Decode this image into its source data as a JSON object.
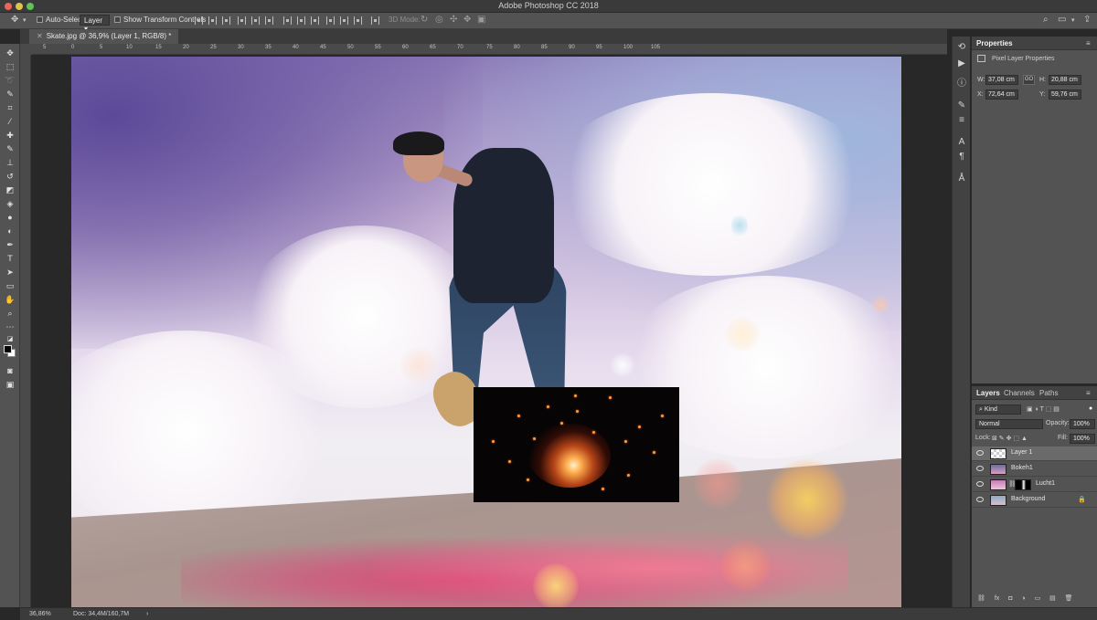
{
  "app": {
    "title": "Adobe Photoshop CC 2018"
  },
  "options_bar": {
    "auto_select_label": "Auto-Select:",
    "auto_select_target": "Layer",
    "show_transform_label": "Show Transform Controls",
    "mode_3d_label": "3D Mode:"
  },
  "document": {
    "tab_title": "Skate.jpg @ 36,9% (Layer 1, RGB/8) *",
    "zoom": "36,86%",
    "doc_size": "Doc: 34,4M/160,7M"
  },
  "ruler": {
    "horizontal": [
      "5",
      "0",
      "5",
      "10",
      "15",
      "20",
      "25",
      "30",
      "35",
      "40",
      "45",
      "50",
      "55",
      "60",
      "65",
      "70",
      "75",
      "80",
      "85",
      "90",
      "95",
      "100",
      "105"
    ]
  },
  "properties": {
    "tab": "Properties",
    "section": "Pixel Layer Properties",
    "w_label": "W:",
    "w_value": "37,08 cm",
    "link_label": "GO",
    "h_label": "H:",
    "h_value": "20,88 cm",
    "x_label": "X:",
    "x_value": "72,64 cm",
    "y_label": "Y:",
    "y_value": "59,76 cm"
  },
  "layers_panel": {
    "tabs": [
      "Layers",
      "Channels",
      "Paths"
    ],
    "filter_kind": "Kind",
    "blend_mode": "Normal",
    "opacity_label": "Opacity:",
    "opacity_value": "100%",
    "lock_label": "Lock:",
    "fill_label": "Fill:",
    "fill_value": "100%",
    "layers": [
      {
        "name": "Layer 1",
        "selected": true
      },
      {
        "name": "Bokeh1",
        "selected": false
      },
      {
        "name": "Lucht1",
        "selected": false
      },
      {
        "name": "Background",
        "selected": false
      }
    ]
  },
  "colors": {
    "panel_bg": "#535353",
    "selection": "#6a6a6a",
    "foreground_swatch": "#000000",
    "background_swatch": "#ffffff"
  }
}
